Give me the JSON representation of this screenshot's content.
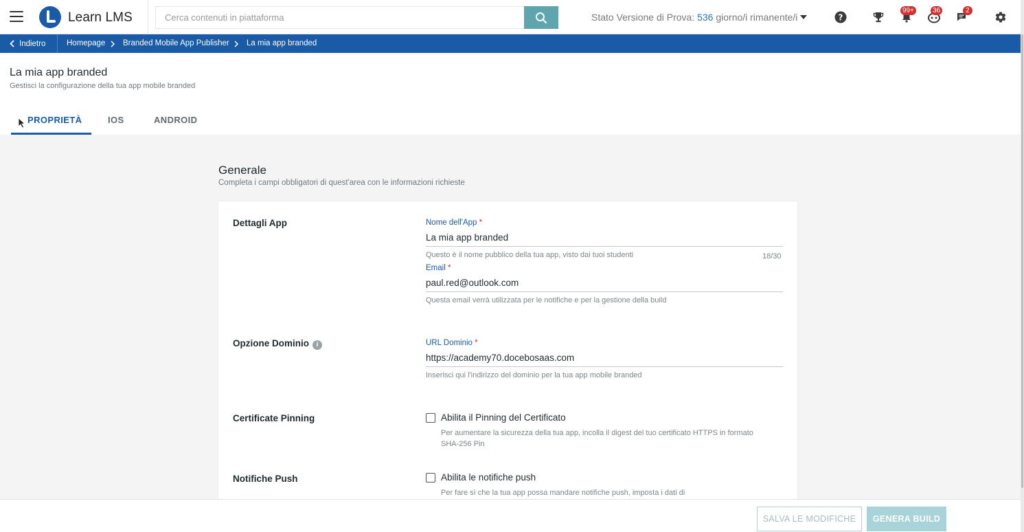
{
  "app": {
    "name": "Learn LMS"
  },
  "search": {
    "placeholder": "Cerca contenuti in piattaforma",
    "value": ""
  },
  "trial": {
    "prefix": "Stato Versione di Prova: ",
    "days": "536",
    "suffix": " giorno/i rimanente/i"
  },
  "header_icons": [
    {
      "name": "help-icon"
    },
    {
      "name": "trophy-icon"
    },
    {
      "name": "bell-icon",
      "badge": "99+"
    },
    {
      "name": "gamification-icon",
      "badge": "36"
    },
    {
      "name": "chat-icon",
      "badge": "2"
    },
    {
      "name": "gear-icon"
    }
  ],
  "breadcrumb": {
    "back": "Indietro",
    "items": [
      "Homepage",
      "Branded Mobile App Publisher",
      "La mia app branded"
    ]
  },
  "page": {
    "title": "La mia app branded",
    "subtitle": "Gestisci la configurazione della tua app mobile branded"
  },
  "tabs": [
    {
      "label": "PROPRIETÀ",
      "active": true
    },
    {
      "label": "IOS",
      "active": false
    },
    {
      "label": "ANDROID",
      "active": false
    }
  ],
  "section": {
    "title": "Generale",
    "subtitle": "Completa i campi obbligatori di quest'area con le informazioni richieste"
  },
  "app_details": {
    "label": "Dettagli App",
    "name_label": "Nome dell'App",
    "name_value": "La mia app branded",
    "name_help": "Questo è il nome pubblico della tua app, visto dai tuoi studenti",
    "name_count": "18/30",
    "email_label": "Email",
    "email_value": "paul.red@outlook.com",
    "email_help": "Questa email verrà utilizzata per le notifiche e per la gestione della build"
  },
  "domain": {
    "label": "Opzione Dominio",
    "url_label": "URL Dominio",
    "url_value": "https://academy70.docebosaas.com",
    "url_help": "Inserisci qui l'indirizzo del dominio per la tua app mobile branded"
  },
  "pinning": {
    "label": "Certificate Pinning",
    "checkbox_label": "Abilita il Pinning del Certificato",
    "checked": false,
    "help": "Per aumentare la sicurezza della tua app, incolla il digest del tuo certificato HTTPS in formato SHA-256 Pin"
  },
  "push": {
    "label": "Notifiche Push",
    "checkbox_label": "Abilita le notifiche push",
    "checked": false,
    "help": "Per fare sì che la tua app possa mandare notifiche push, imposta i dati di"
  },
  "footer": {
    "save_label": "SALVA LE MODIFICHE",
    "build_label": "GENERA BUILD"
  },
  "colors": {
    "brand_blue": "#1a5ba8",
    "search_button": "#5fa5ae",
    "badge_red": "#d32f2f",
    "build_button_disabled": "#a8d3d8"
  }
}
